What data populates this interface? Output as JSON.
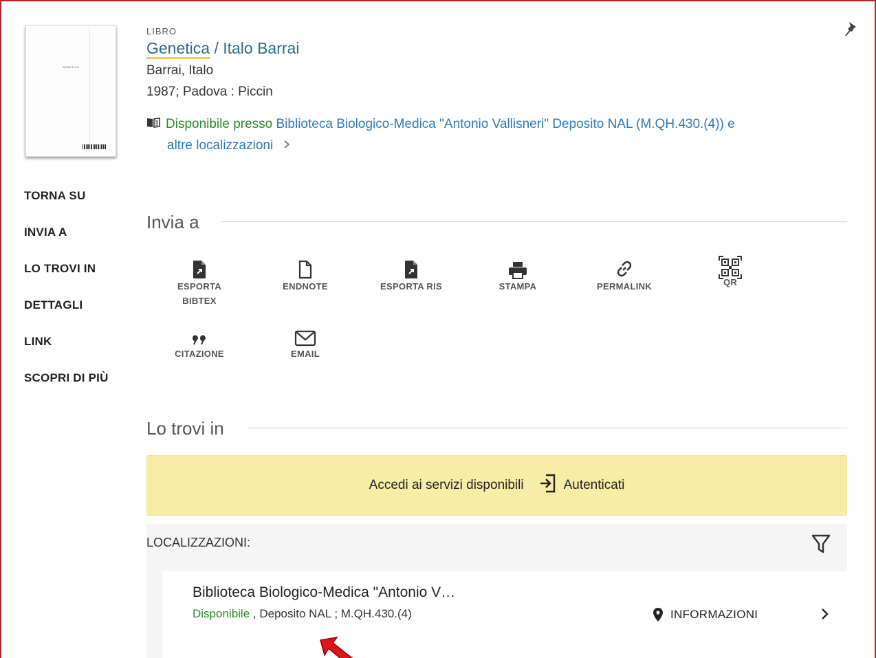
{
  "record": {
    "type": "LIBRO",
    "title_main": "Genetica",
    "title_rest": " / Italo Barrai",
    "author": "Barrai, Italo",
    "publication": "1987; Padova : Piccin",
    "availability_status": "Disponibile presso",
    "availability_location": "Biblioteca Biologico-Medica \"Antonio Vallisneri\"  Deposito NAL (M.QH.430.(4)) e",
    "availability_more": "altre localizzazioni",
    "cover_title": "GENETICA"
  },
  "nav": {
    "items": [
      "TORNA SU",
      "INVIA A",
      "LO TROVI IN",
      "DETTAGLI",
      "LINK",
      "SCOPRI DI PIÙ"
    ]
  },
  "send_to": {
    "heading": "Invia a",
    "actions": [
      {
        "label": "ESPORTA",
        "label2": "BIBTEX",
        "icon": "file-export-icon"
      },
      {
        "label": "ENDNOTE",
        "label2": "",
        "icon": "document-icon"
      },
      {
        "label": "ESPORTA RIS",
        "label2": "",
        "icon": "file-export-icon"
      },
      {
        "label": "STAMPA",
        "label2": "",
        "icon": "print-icon"
      },
      {
        "label": "PERMALINK",
        "label2": "",
        "icon": "link-icon"
      },
      {
        "label": "QR",
        "label2": "",
        "icon": "qr-icon"
      },
      {
        "label": "CITAZIONE",
        "label2": "",
        "icon": "quote-icon"
      },
      {
        "label": "EMAIL",
        "label2": "",
        "icon": "email-icon"
      }
    ]
  },
  "find_in": {
    "heading": "Lo trovi in",
    "auth_text": "Accedi ai servizi disponibili",
    "auth_button": "Autenticati",
    "locations_label": "LOCALIZZAZIONI:",
    "location": {
      "name": "Biblioteca Biologico-Medica \"Antonio V…",
      "status": "Disponibile",
      "detail": " , Deposito NAL ; M.QH.430.(4)",
      "info_label": "INFORMAZIONI"
    }
  },
  "colors": {
    "link": "#2d6c88",
    "available": "#2a8a2a",
    "auth_bar": "#f6eda6",
    "highlight": "#f3d24f",
    "annotation_arrow": "#e0141b"
  }
}
